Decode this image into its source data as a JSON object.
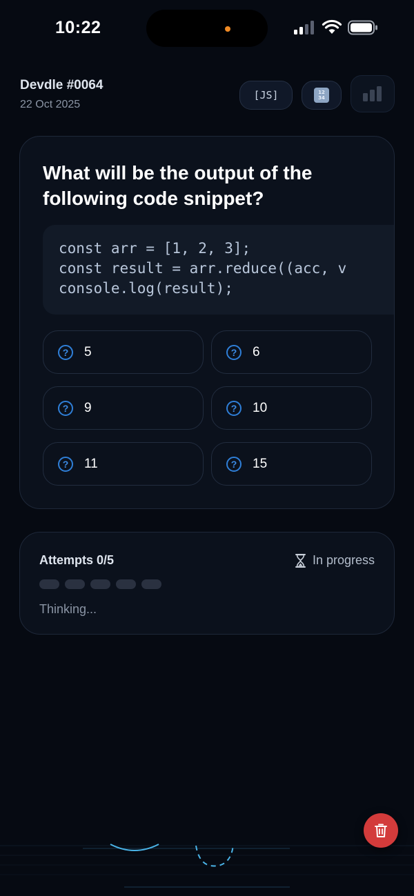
{
  "status_bar": {
    "time": "10:22"
  },
  "header": {
    "title": "Devdle #0064",
    "date": "22 Oct 2025",
    "language_label": "[JS]",
    "numbers_icon": "numbers-keycap-icon",
    "stats_icon": "bar-chart-icon"
  },
  "question": {
    "text": "What will be the output of the following code snippet?",
    "code_lines": [
      "const arr = [1, 2, 3];",
      "const result = arr.reduce((acc, v",
      "console.log(result);"
    ],
    "options": [
      {
        "label": "5"
      },
      {
        "label": "6"
      },
      {
        "label": "9"
      },
      {
        "label": "10"
      },
      {
        "label": "11"
      },
      {
        "label": "15"
      }
    ]
  },
  "attempts": {
    "label": "Attempts 0/5",
    "status": "In progress",
    "used": 0,
    "total": 5,
    "message": "Thinking..."
  },
  "colors": {
    "background": "#060a12",
    "card": "#0b111c",
    "accent": "#2f7fd8",
    "delete": "#d33b3b"
  }
}
